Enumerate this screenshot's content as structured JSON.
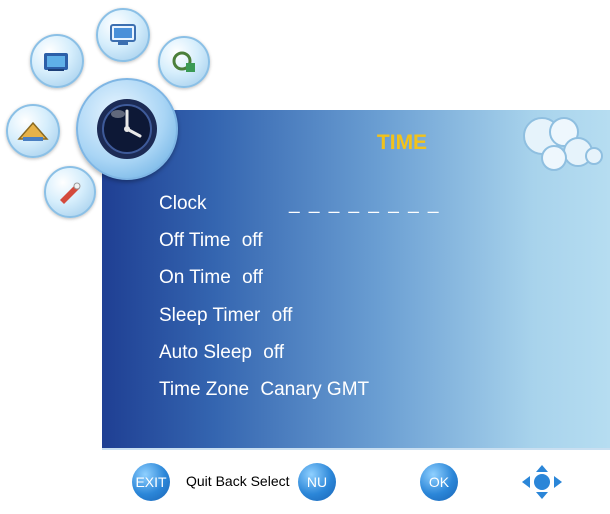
{
  "menu": {
    "title": "TIME",
    "items": [
      {
        "label": "Clock",
        "value": "_ _ _ _   _ _ _ _"
      },
      {
        "label": "Off Time",
        "value": "off"
      },
      {
        "label": "On Time",
        "value": "off"
      },
      {
        "label": "Sleep Timer",
        "value": "off"
      },
      {
        "label": "Auto Sleep",
        "value": "off"
      },
      {
        "label": "Time Zone",
        "value": "Canary GMT"
      }
    ]
  },
  "footer": {
    "exit_label": "EXIT",
    "hint_text": "Quit Back Select",
    "menu_label": "NU",
    "ok_label": "OK"
  },
  "colors": {
    "title": "#f2c21b",
    "panel_dark": "#1f3f93",
    "panel_light": "#b6ddf1",
    "button": "#2b86d8"
  },
  "icons": [
    "picture-icon",
    "tv-icon",
    "channel-icon",
    "time-icon",
    "lock-icon",
    "setup-icon",
    "dpad-icon"
  ]
}
